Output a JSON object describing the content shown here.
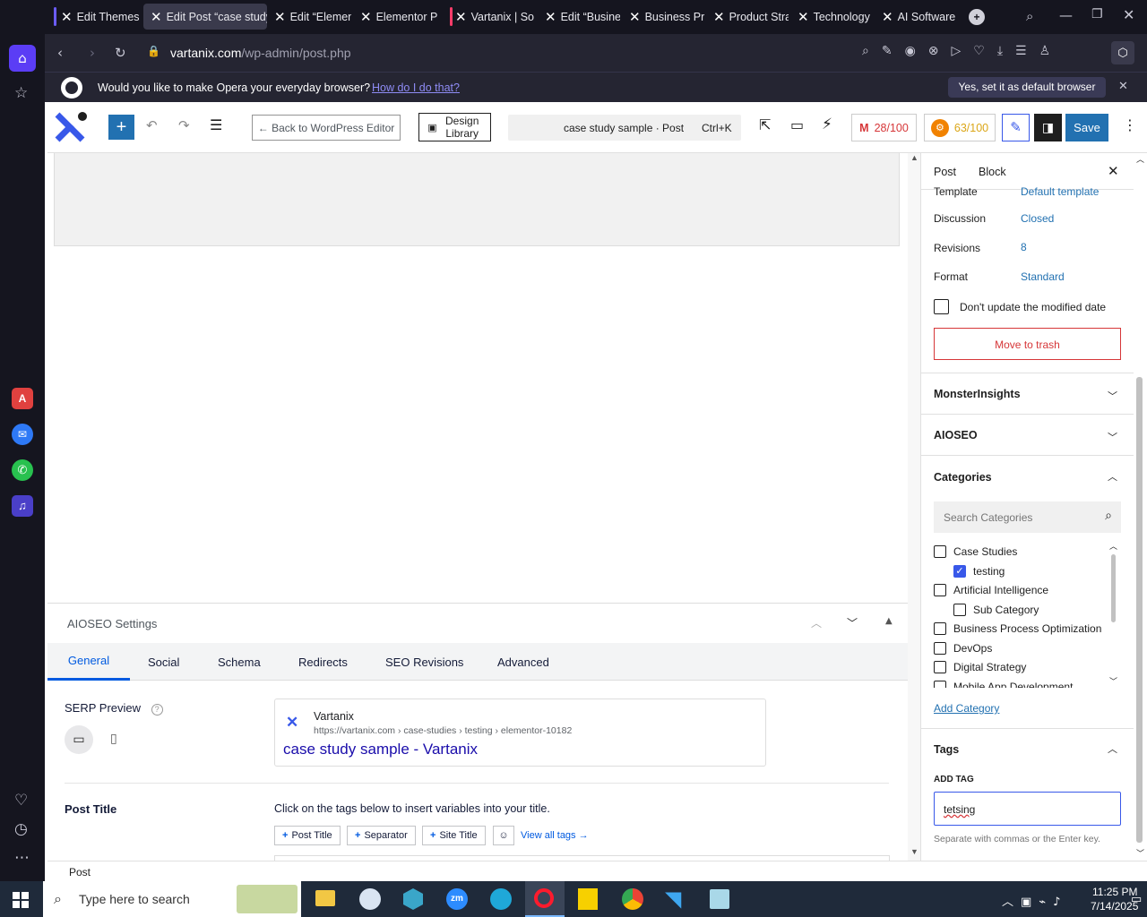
{
  "browser": {
    "tabs": [
      {
        "label": "Edit Themes",
        "active": false
      },
      {
        "label": "Edit Post “case study",
        "active": true
      },
      {
        "label": "Edit “Elemen",
        "active": false
      },
      {
        "label": "Elementor P",
        "active": false
      },
      {
        "label": "Vartanix | So",
        "active": false
      },
      {
        "label": "Edit “Busine",
        "active": false
      },
      {
        "label": "Business Pro",
        "active": false
      },
      {
        "label": "Product Stra",
        "active": false
      },
      {
        "label": "Technology",
        "active": false
      },
      {
        "label": "AI Software",
        "active": false
      }
    ],
    "url_host": "vartanix.com",
    "url_path": "/wp-admin/post.php",
    "default_prompt": "Would you like to make Opera your everyday browser?",
    "default_link": "How do I do that?",
    "default_button": "Yes, set it as default browser"
  },
  "toolbar": {
    "back_label": "← Back to WordPress Editor",
    "design_library": "Design Library",
    "command_title": "case study sample · Post",
    "command_shortcut": "Ctrl+K",
    "score_1": "28/100",
    "score_2": "63/100",
    "save_label": "Save"
  },
  "aioseo": {
    "title": "AIOSEO Settings",
    "tabs": [
      "General",
      "Social",
      "Schema",
      "Redirects",
      "SEO Revisions",
      "Advanced"
    ],
    "active_tab": "General",
    "serp_label": "SERP Preview",
    "serp_site": "Vartanix",
    "serp_url": "https://vartanix.com › case-studies › testing › elementor-10182",
    "serp_title": "case study sample - Vartanix",
    "post_title_label": "Post Title",
    "post_title_hint": "Click on the tags below to insert variables into your title.",
    "tag_buttons": [
      "Post Title",
      "Separator",
      "Site Title"
    ],
    "view_all": "View all tags →"
  },
  "sidebar": {
    "tab_post": "Post",
    "tab_block": "Block",
    "template_label": "Template",
    "template_value": "Default template",
    "discussion_label": "Discussion",
    "discussion_value": "Closed",
    "revisions_label": "Revisions",
    "revisions_value": "8",
    "format_label": "Format",
    "format_value": "Standard",
    "dont_update": "Don't update the modified date",
    "trash": "Move to trash",
    "monsterinsights": "MonsterInsights",
    "aioseo": "AIOSEO",
    "categories_title": "Categories",
    "search_categories": "Search Categories",
    "categories": [
      {
        "label": "Case Studies",
        "checked": false,
        "child": false
      },
      {
        "label": "testing",
        "checked": true,
        "child": true
      },
      {
        "label": "Artificial Intelligence",
        "checked": false,
        "child": false
      },
      {
        "label": "Sub Category",
        "checked": false,
        "child": true
      },
      {
        "label": "Business Process Optimization",
        "checked": false,
        "child": false
      },
      {
        "label": "DevOps",
        "checked": false,
        "child": false
      },
      {
        "label": "Digital Strategy",
        "checked": false,
        "child": false
      },
      {
        "label": "Mobile App Development",
        "checked": false,
        "child": false
      }
    ],
    "add_category": "Add Category",
    "tags_title": "Tags",
    "add_tag_label": "ADD TAG",
    "tag_input_value": "tetsing",
    "tag_hint": "Separate with commas or the Enter key."
  },
  "status": {
    "breadcrumb": "Post"
  },
  "taskbar": {
    "search_placeholder": "Type here to search",
    "time": "11:25 PM",
    "date": "7/14/2025"
  }
}
